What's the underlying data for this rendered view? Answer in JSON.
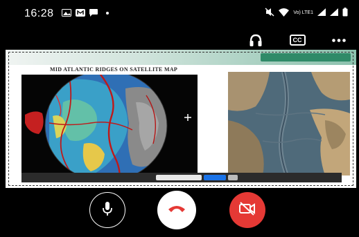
{
  "status_bar": {
    "time": "16:28",
    "network_label": "Vo) LTE1"
  },
  "slide": {
    "title": "MID ATLANTIC RIDGES ON SATELLITE MAP"
  },
  "icons": {
    "status_left": [
      "gallery-icon",
      "messenger-icon",
      "chat-icon"
    ],
    "status_right": [
      "mute-icon",
      "wifi-icon",
      "signal-icon",
      "signal-icon",
      "battery-icon"
    ],
    "call_tools": [
      "headphones-icon",
      "closed-caption-icon",
      "more-options-icon"
    ],
    "controls": [
      "microphone-icon",
      "end-call-icon",
      "camera-off-icon"
    ]
  },
  "colors": {
    "background": "#000000",
    "end_call": "#e53935",
    "camera_off": "#e53935",
    "accent": "#1a73e8"
  },
  "call_tools": {
    "cc_label": "CC"
  }
}
